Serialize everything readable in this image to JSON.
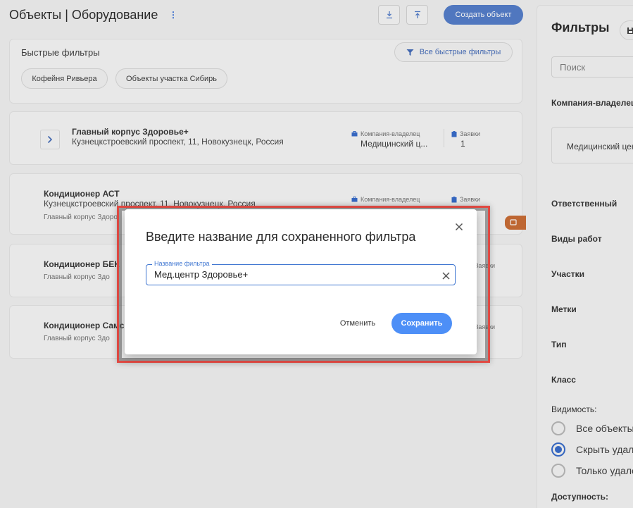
{
  "header": {
    "title": "Объекты | Оборудование",
    "more_icon": "vertical-dots-icon",
    "download_icon": "download-icon",
    "upload_icon": "upload-icon",
    "create_label": "Создать объект"
  },
  "quick_filters": {
    "title": "Быстрые фильтры",
    "all_label": "Все быстрые фильтры",
    "chips": [
      "Кофейня Ривьера",
      "Объекты участка Сибирь"
    ]
  },
  "cards": [
    {
      "title": "Главный корпус Здоровье+",
      "address": "Кузнецкстроевский проспект, 11, Новокузнецк, Россия",
      "company_label": "Компания-владелец",
      "company_value": "Медицинский ц...",
      "requests_label": "Заявки",
      "requests_value": "1"
    },
    {
      "title": "Кондиционер АСТ",
      "address": "Кузнецкстроевский проспект, 11, Новокузнецк, Россия",
      "parent": "Главный корпус Здоро",
      "company_label": "Компания-владелец",
      "requests_label": "Заявки"
    },
    {
      "title": "Кондиционер БЕК",
      "parent": "Главный корпус Здо",
      "requests_label": "Заявки"
    },
    {
      "title": "Кондиционер Самс",
      "parent": "Главный корпус Здо",
      "requests_label": "Заявки"
    }
  ],
  "filters_panel": {
    "title": "Фильтры",
    "search_placeholder": "Поиск",
    "company_label": "Компания-владелец",
    "company_value": "Медицинский центр",
    "sections": [
      "Ответственный",
      "Виды работ",
      "Участки",
      "Метки",
      "Тип",
      "Класс"
    ],
    "visibility_label": "Видимость:",
    "visibility_options": [
      {
        "label": "Все объекты",
        "checked": false
      },
      {
        "label": "Скрыть удаленные",
        "checked": true
      },
      {
        "label": "Только удаленные",
        "checked": false
      }
    ],
    "availability_label": "Доступность:"
  },
  "dialog": {
    "title": "Введите название для сохраненного фильтра",
    "field_label": "Название фильтра",
    "field_value": "Мед.центр Здоровье+",
    "cancel_label": "Отменить",
    "save_label": "Сохранить"
  },
  "colors": {
    "primary": "#4a77c9",
    "save_button": "#4d8ff7",
    "highlight": "#e14a43",
    "orange_tag": "#c8652a"
  }
}
